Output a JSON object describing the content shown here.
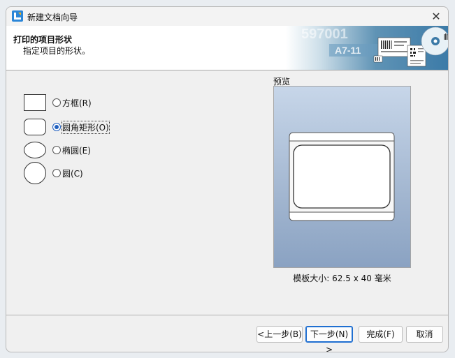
{
  "window": {
    "title": "新建文档向导",
    "close_glyph": "✕"
  },
  "header": {
    "title": "打印的项目形状",
    "subtitle": "指定项目的形状。",
    "banner_text_1": "597001",
    "banner_text_2": "A7-11"
  },
  "shapes": [
    {
      "label": "方框(R)",
      "selected": false
    },
    {
      "label": "圆角矩形(O)",
      "selected": true
    },
    {
      "label": "椭圆(E)",
      "selected": false
    },
    {
      "label": "圆(C)",
      "selected": false
    }
  ],
  "preview": {
    "label": "预览",
    "size_text": "模板大小:  62.5 x 40 毫米"
  },
  "buttons": {
    "back": "<上一步(B)",
    "next": "下一步(N) >",
    "finish": "完成(F)",
    "cancel": "取消"
  },
  "colors": {
    "accent": "#1f5fbf",
    "preview_top": "#c7d6e9",
    "preview_bottom": "#8aa2c2"
  }
}
